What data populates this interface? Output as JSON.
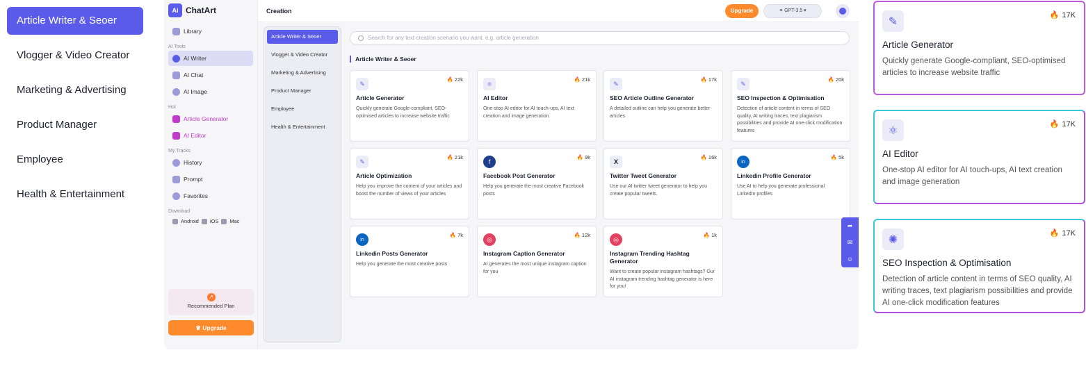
{
  "big_categories": [
    {
      "label": "Article Writer & Seoer",
      "active": true
    },
    {
      "label": "Vlogger & Video Creator"
    },
    {
      "label": "Marketing & Advertising"
    },
    {
      "label": "Product Manager"
    },
    {
      "label": "Employee"
    },
    {
      "label": "Health & Entertainment"
    }
  ],
  "app": {
    "brand": "ChatArt",
    "logo_mark": "Ai",
    "sidebar": {
      "library": "Library",
      "ai_tools_header": "AI Tools",
      "ai_writer": "AI Writer",
      "ai_chat": "AI Chat",
      "ai_image": "AI Image",
      "hot_header": "Hot",
      "hot_article": "Article Generator",
      "hot_editor": "AI Editor",
      "tracks_header": "My Tracks",
      "history": "History",
      "prompt": "Prompt",
      "favorites": "Favorites",
      "download_header": "Download",
      "android": "Android",
      "ios": "iOS",
      "mac": "Mac",
      "plan_label": "Recommended Plan",
      "upgrade": "Upgrade"
    },
    "topbar": {
      "title": "Creation",
      "upgrade": "Upgrade",
      "model": "GPT-3.5"
    },
    "categories": [
      {
        "label": "Article Writer & Seoer",
        "active": true
      },
      {
        "label": "Vlogger & Video Creator"
      },
      {
        "label": "Marketing & Advertising"
      },
      {
        "label": "Product Manager"
      },
      {
        "label": "Employee"
      },
      {
        "label": "Health & Entertainment"
      }
    ],
    "search_placeholder": "Search for any text creation scenario you want. e.g. article generation",
    "section_title": "Article Writer & Seoer",
    "cards": [
      {
        "icon": "edit-doc-icon",
        "count": "22k",
        "title": "Article Generator",
        "desc": "Quickly generate Google-compliant, SEO-optimised articles to increase website traffic"
      },
      {
        "icon": "atom-icon",
        "count": "21k",
        "title": "AI Editor",
        "desc": "One-stop AI editor for AI touch-ups, AI text creation and image generation"
      },
      {
        "icon": "edit-doc-icon",
        "count": "17k",
        "title": "SEO Article Outline Generator",
        "desc": "A detailed outline can help you generate better articles"
      },
      {
        "icon": "edit-doc-icon",
        "count": "20k",
        "title": "SEO Inspection & Optimisation",
        "desc": "Detection of article content in terms of SEO quality, AI writing traces, text plagiarism possibilities and provide AI one-click modification features"
      },
      {
        "icon": "edit-doc-icon",
        "count": "21k",
        "title": "Article Optimization",
        "desc": "Help you improve the content of your articles and boost the number of views of your articles"
      },
      {
        "icon": "facebook-icon",
        "count": "9k",
        "title": "Facebook Post Generator",
        "desc": "Help you generate the most creative Facebook posts"
      },
      {
        "icon": "x-twitter-icon",
        "count": "16k",
        "title": "Twitter Tweet Generator",
        "desc": "Use our AI twitter tweet generator to help you create popular tweets."
      },
      {
        "icon": "linkedin-icon",
        "count": "5k",
        "title": "Linkedin Profile Generator",
        "desc": "Use AI to help you generate professional LinkedIn profiles"
      },
      {
        "icon": "linkedin-icon",
        "count": "7k",
        "title": "Linkedin Posts Generator",
        "desc": "Help you generate the most creative posts"
      },
      {
        "icon": "instagram-icon",
        "count": "12k",
        "title": "Instagram Caption Generator",
        "desc": "AI generates the most unique instagram caption for you"
      },
      {
        "icon": "instagram-icon",
        "count": "1k",
        "title": "Instagram Trending Hashtag Generator",
        "desc": "Want to create popular instagram hashtags? Our AI instagram trending hashtag generator is here for you!"
      }
    ]
  },
  "big_cards": [
    {
      "icon": "edit-doc-icon",
      "count": "17K",
      "title": "Article Generator",
      "desc": "Quickly generate Google-compliant, SEO-optimised articles to increase website traffic"
    },
    {
      "icon": "atom-icon",
      "count": "17K",
      "title": "AI Editor",
      "desc": "One-stop AI editor for AI touch-ups, AI text creation and image generation"
    },
    {
      "icon": "magic-icon",
      "count": "17K",
      "title": "SEO Inspection & Optimisation",
      "desc": "Detection of article content in terms of SEO quality, AI writing traces, text plagiarism possibilities and provide AI one-click modification features"
    }
  ],
  "colors": {
    "accent": "#5b5bea",
    "orange": "#ff8a2b",
    "hot": "#c13ac9"
  }
}
